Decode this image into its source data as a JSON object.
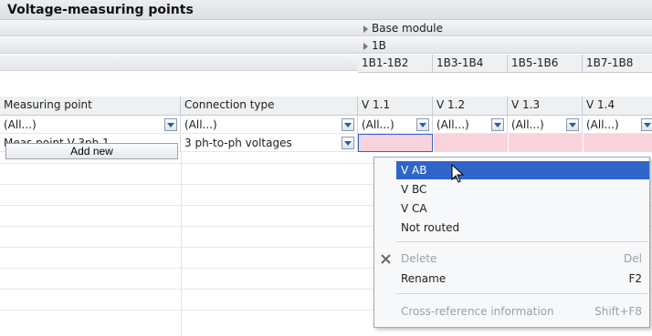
{
  "title": "Voltage-measuring points",
  "tree": {
    "base_module": "Base module",
    "group": "1B"
  },
  "terminal_groups": [
    "1B1-1B2",
    "1B3-1B4",
    "1B5-1B6",
    "1B7-1B8"
  ],
  "columns": {
    "measuring_point": "Measuring point",
    "connection_type": "Connection type",
    "v": [
      "V 1.1",
      "V 1.2",
      "V 1.3",
      "V 1.4"
    ]
  },
  "filter_value": "(All...)",
  "row": {
    "measuring_point": "Meas.point V-3ph 1",
    "connection_type": "3 ph-to-ph voltages"
  },
  "add_new": "Add new",
  "menu": {
    "items": [
      "V AB",
      "V BC",
      "V CA",
      "Not routed"
    ],
    "delete": {
      "label": "Delete",
      "shortcut": "Del"
    },
    "rename": {
      "label": "Rename",
      "shortcut": "F2"
    },
    "crossref": {
      "label": "Cross-reference information",
      "shortcut": "Shift+F8"
    }
  },
  "colors": {
    "selection": "#2f65c8",
    "pink": "#f9d3dc"
  }
}
